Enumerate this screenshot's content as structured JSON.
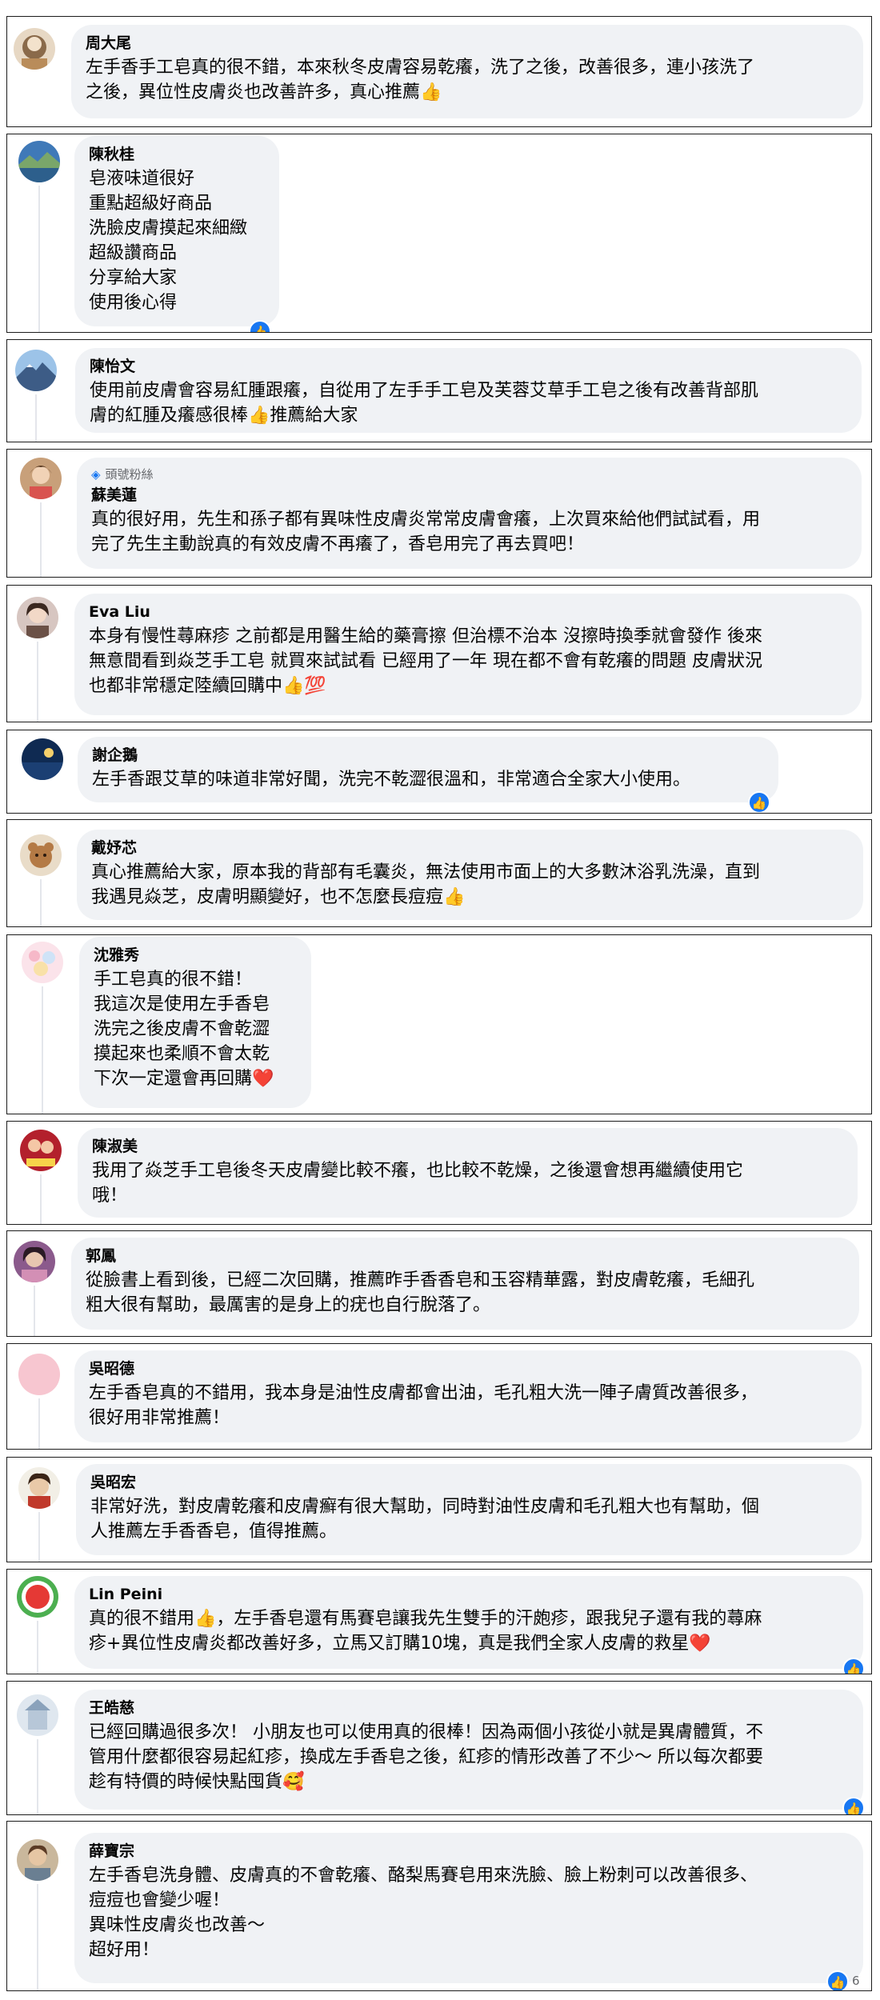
{
  "comments": [
    {
      "name": "周大尾",
      "badge": "",
      "text": "左手香手工皂真的很不錯，本來秋冬皮膚容易乾癢，洗了之後，改善很多，連小孩洗了\n之後，異位性皮膚炎也改善許多，真心推薦👍",
      "reactions": false,
      "reaction_count": ""
    },
    {
      "name": "陳秋桂",
      "badge": "",
      "text": "皂液味道很好\n重點超級好商品\n洗臉皮膚摸起來細緻\n超級讚商品\n分享給大家\n使用後心得",
      "reactions": true,
      "reaction_count": ""
    },
    {
      "name": "陳怡文",
      "badge": "",
      "text": "使用前皮膚會容易紅腫跟癢，自從用了左手手工皂及芙蓉艾草手工皂之後有改善背部肌\n膚的紅腫及癢感很棒👍推薦給大家",
      "reactions": false,
      "reaction_count": ""
    },
    {
      "name": "蘇美蓮",
      "badge": "頭號粉絲",
      "text": "真的很好用，先生和孫子都有異味性皮膚炎常常皮膚會癢，上次買來給他們試試看，用\n完了先生主動說真的有效皮膚不再癢了，香皂用完了再去買吧！",
      "reactions": false,
      "reaction_count": ""
    },
    {
      "name": "Eva Liu",
      "badge": "",
      "text": "本身有慢性蕁麻疹 之前都是用醫生給的藥膏擦 但治標不治本 沒擦時換季就會發作 後來\n無意間看到焱芝手工皂 就買來試試看 已經用了一年 現在都不會有乾癢的問題 皮膚狀況\n也都非常穩定陸續回購中👍💯",
      "reactions": false,
      "reaction_count": ""
    },
    {
      "name": "謝企鵝",
      "badge": "",
      "text": "左手香跟艾草的味道非常好聞，洗完不乾澀很溫和，非常適合全家大小使用。",
      "reactions": true,
      "reaction_count": ""
    },
    {
      "name": "戴妤芯",
      "badge": "",
      "text": "真心推薦給大家，原本我的背部有毛囊炎，無法使用市面上的大多數沐浴乳洗澡，直到\n我遇見焱芝，皮膚明顯變好，也不怎麼長痘痘👍",
      "reactions": false,
      "reaction_count": ""
    },
    {
      "name": "沈雅秀",
      "badge": "",
      "text": "手工皂真的很不錯！\n我這次是使用左手香皂\n洗完之後皮膚不會乾澀\n摸起來也柔順不會太乾\n下次一定還會再回購❤️",
      "reactions": false,
      "reaction_count": ""
    },
    {
      "name": "陳淑美",
      "badge": "",
      "text": "我用了焱芝手工皂後冬天皮膚變比較不癢，也比較不乾燥，之後還會想再繼續使用它\n哦！",
      "reactions": false,
      "reaction_count": ""
    },
    {
      "name": "郭鳳",
      "badge": "",
      "text": "從臉書上看到後，已經二次回購，推薦昨手香香皂和玉容精華露，對皮膚乾癢，毛細孔\n粗大很有幫助，最厲害的是身上的疣也自行脫落了。",
      "reactions": false,
      "reaction_count": ""
    },
    {
      "name": "吳昭德",
      "badge": "",
      "text": "左手香皂真的不錯用，我本身是油性皮膚都會出油，毛孔粗大洗一陣子膚質改善很多，\n很好用非常推薦！",
      "reactions": false,
      "reaction_count": ""
    },
    {
      "name": "吳昭宏",
      "badge": "",
      "text": "非常好洗，對皮膚乾癢和皮膚癬有很大幫助，同時對油性皮膚和毛孔粗大也有幫助，個\n人推薦左手香香皂，值得推薦。",
      "reactions": false,
      "reaction_count": ""
    },
    {
      "name": "Lin Peini",
      "badge": "",
      "text": "真的很不錯用👍，左手香皂還有馬賽皂讓我先生雙手的汗皰疹，跟我兒子還有我的蕁麻\n疹+異位性皮膚炎都改善好多，立馬又訂購10塊，真是我們全家人皮膚的救星❤️",
      "reactions": true,
      "reaction_count": ""
    },
    {
      "name": "王皓慈",
      "badge": "",
      "text": "已經回購過很多次！ 小朋友也可以使用真的很棒！因為兩個小孩從小就是異膚體質，不\n管用什麼都很容易起紅疹，換成左手香皂之後，紅疹的情形改善了不少～ 所以每次都要\n趁有特價的時候快點囤貨🥰",
      "reactions": true,
      "reaction_count": ""
    },
    {
      "name": "薛寶宗",
      "badge": "",
      "text": "左手香皂洗身體、皮膚真的不會乾癢、酪梨馬賽皂用來洗臉、臉上粉刺可以改善很多、\n痘痘也會變少喔！\n異味性皮膚炎也改善～\n超好用！",
      "reactions": true,
      "reaction_count": "6"
    }
  ],
  "colors": {
    "bubble": "#f0f2f5",
    "card_border": "#1c1c1c",
    "like_blue": "#1877f2",
    "name_text": "#050505",
    "meta_text": "#65676b"
  },
  "icons": {
    "badge": "diamond-icon",
    "reaction": "thumbs-up-icon"
  }
}
